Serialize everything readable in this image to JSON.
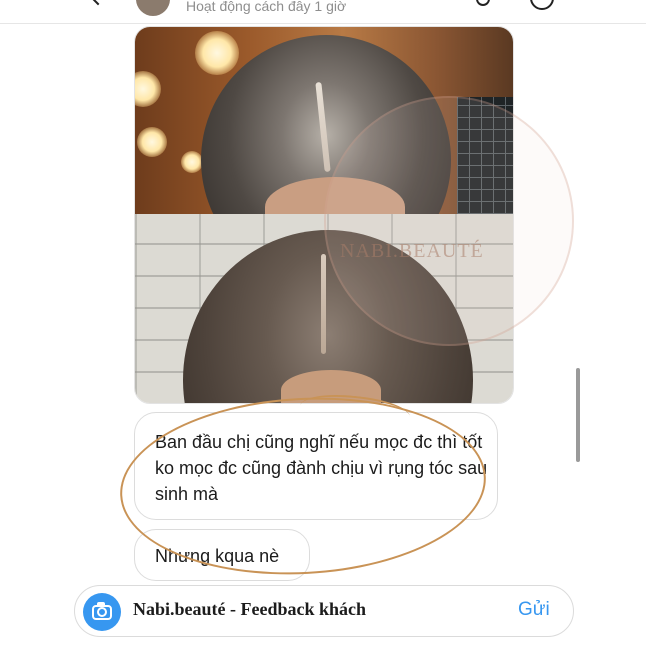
{
  "header": {
    "status": "Hoạt động cách đây 1 giờ"
  },
  "messages": [
    {
      "text": "Ban đầu chị cũng nghĩ nếu mọc đc thì tốt ko mọc đc cũng đành chịu vì rụng tóc sau sinh mà"
    },
    {
      "text": "Nhưng kqua nè"
    }
  ],
  "watermark": {
    "text": "NABI.BEAUTÉ"
  },
  "composer": {
    "input_value": "Nabi.beauté - Feedback khách",
    "send_label": "Gửi"
  },
  "colors": {
    "accent": "#3797f0",
    "annotation": "#c99356"
  },
  "icons": {
    "back": "chevron-left-icon",
    "call": "phone-icon",
    "info": "info-icon",
    "camera": "camera-icon"
  }
}
